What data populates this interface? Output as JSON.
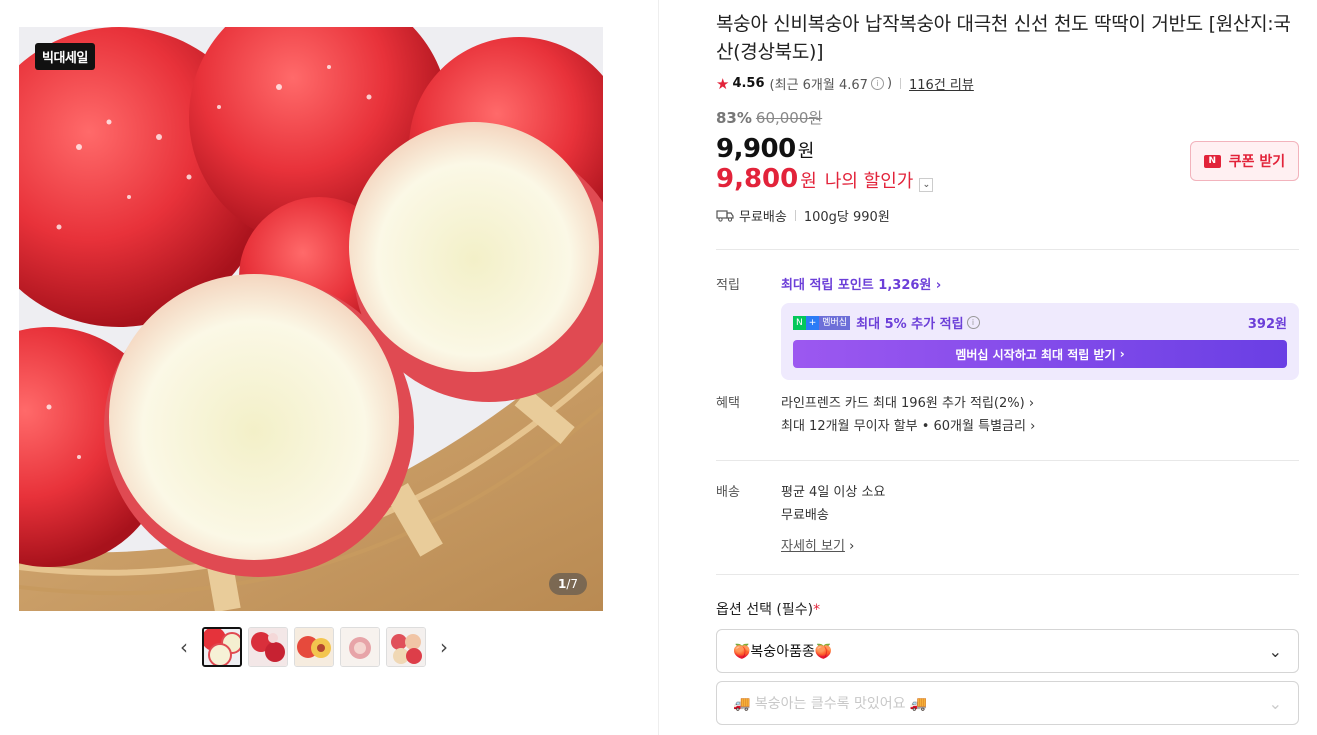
{
  "gallery": {
    "badge": "빅대세일",
    "counter_current": "1",
    "counter_total": "/7",
    "prev_icon": "chevron-left-icon",
    "next_icon": "chevron-right-icon"
  },
  "product": {
    "title": "복숭아 신비복숭아 납작복숭아 대극천 신선 천도 딱딱이 거반도 [원산지:국산(경상북도)]",
    "rating": "4.56",
    "recent_rating": "(최근 6개월 4.67",
    "recent_rating_close": ")",
    "reviews": "116건 리뷰"
  },
  "price": {
    "discount_rate": "83%",
    "original": "60,000원",
    "sale": "9,900",
    "won": "원",
    "my_price": "9,800",
    "my_price_label": "나의 할인가",
    "coupon_label": "쿠폰 받기",
    "coupon_icon": "N",
    "shipping": "무료배송",
    "unit_price": "100g당 990원"
  },
  "points": {
    "label": "적립",
    "max_points": "최대 적립 포인트 1,326원",
    "member_text": "최대 5% 추가 적립",
    "member_points": "392원",
    "badge_n": "N",
    "badge_plus": "+",
    "badge_member": "멤버십",
    "member_button": "멤버십 시작하고 최대 적립 받기"
  },
  "benefits": {
    "label": "혜택",
    "line1": "라인프렌즈 카드 최대 196원 추가 적립(2%)",
    "line2": "최대 12개월 무이자 할부 • 60개월 특별금리"
  },
  "delivery": {
    "label": "배송",
    "line1": "평균 4일 이상 소요",
    "line2": "무료배송",
    "details_link": "자세히 보기"
  },
  "options": {
    "title": "옵션 선택 (필수)",
    "required_mark": "*",
    "select1": "🍑복숭아품종🍑",
    "select2": "🚚 복숭아는 클수록 맛있어요 🚚"
  }
}
